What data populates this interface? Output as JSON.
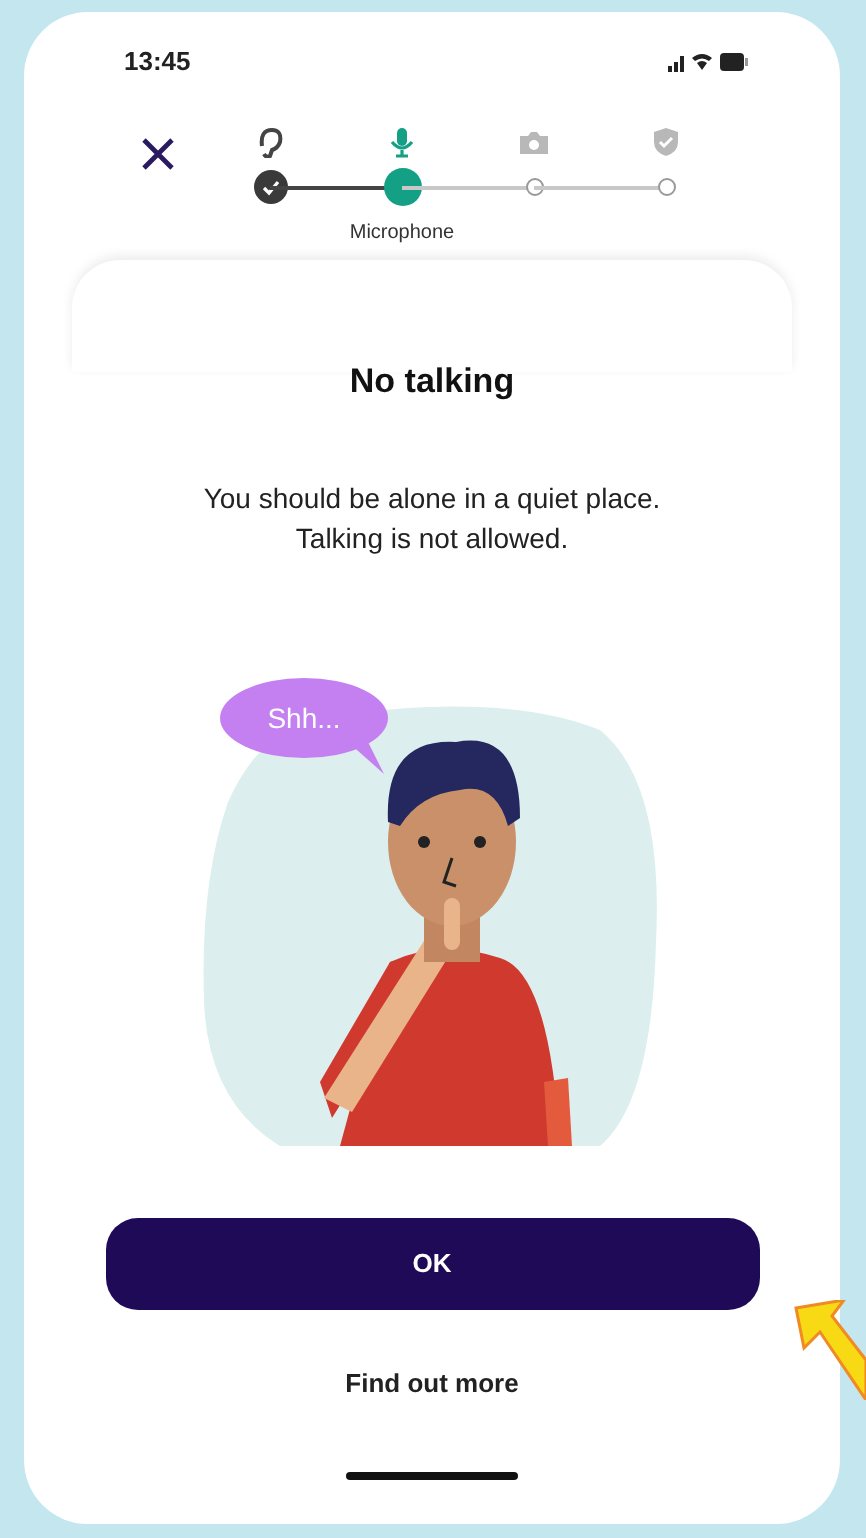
{
  "status_bar": {
    "time": "13:45"
  },
  "steps": [
    {
      "kind": "ear",
      "completed": true,
      "selected": false
    },
    {
      "kind": "microphone",
      "completed": false,
      "selected": true,
      "label": "Microphone"
    },
    {
      "kind": "camera",
      "completed": false,
      "selected": false
    },
    {
      "kind": "shield",
      "completed": false,
      "selected": false
    }
  ],
  "title": "No talking",
  "message": "You should be alone in a quiet place. Talking is not allowed.",
  "illustration": {
    "speech": "Shh..."
  },
  "buttons": {
    "primary": "OK",
    "secondary": "Find out more"
  }
}
